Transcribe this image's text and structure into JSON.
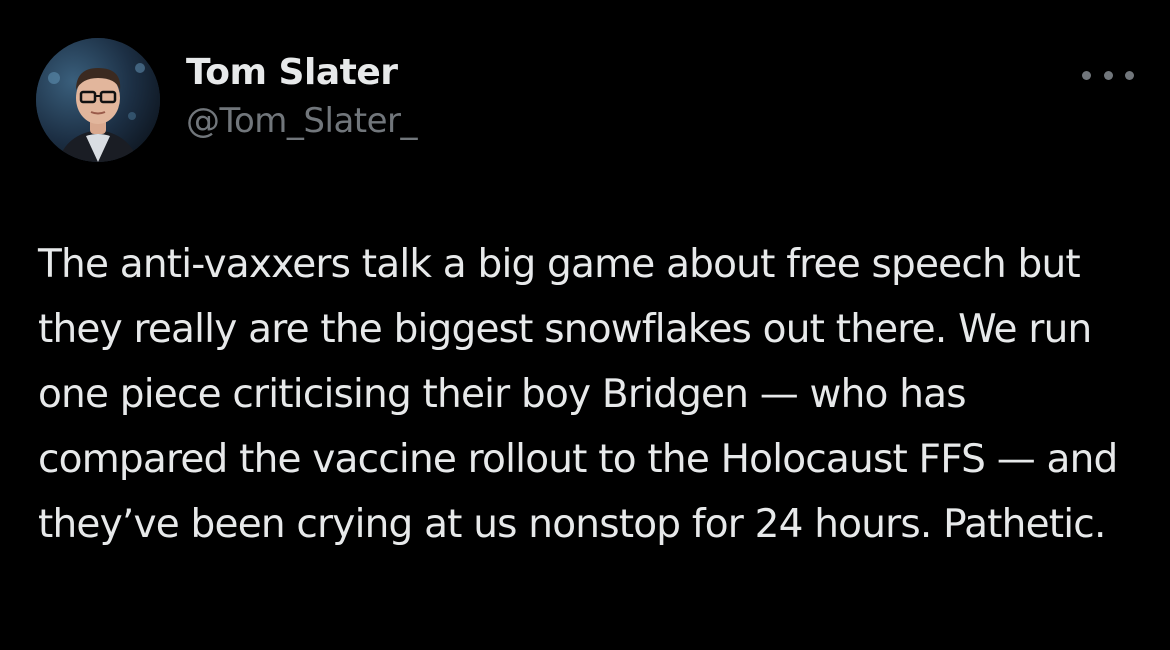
{
  "tweet": {
    "author": {
      "display_name": "Tom Slater",
      "handle": "@Tom_Slater_",
      "avatar_icon": "profile-photo-icon"
    },
    "more_icon": "more-options-icon",
    "text": "The anti-vaxxers talk a big game about free speech but they really are the biggest snowflakes out there. We run one piece criticising their boy Bridgen — who has compared the vaccine rollout to the Holocaust FFS — and they’ve been crying at us nonstop for 24 hours. Pathetic."
  },
  "colors": {
    "background": "#000000",
    "primary_text": "#e7e9ea",
    "secondary_text": "#71767b"
  }
}
